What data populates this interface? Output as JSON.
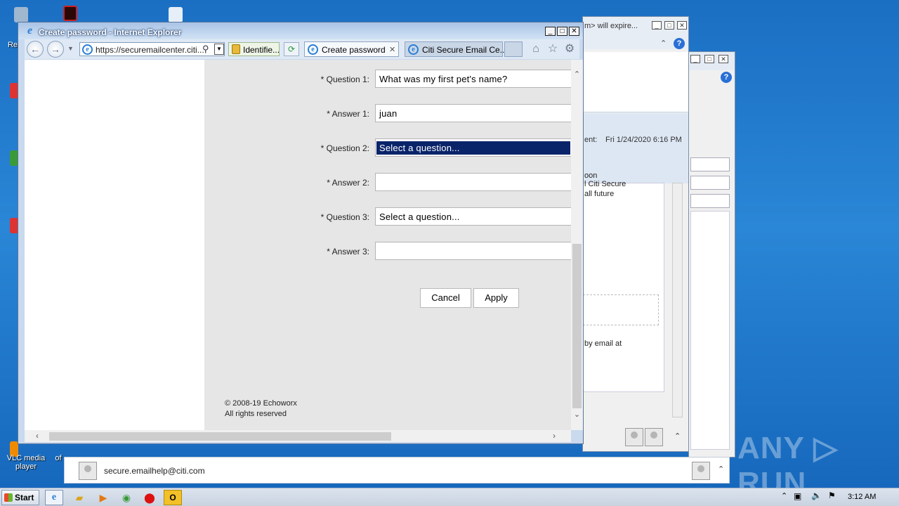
{
  "desktop": {
    "icons": [
      {
        "label": "Re"
      },
      {
        "label": "VLC media player"
      },
      {
        "label": "of"
      }
    ]
  },
  "outlook_bg": {
    "subject_fragment": "m> will expire...",
    "sent_label": "ent:",
    "sent_value": "Fri 1/24/2020 6:16 PM",
    "text_soon": "oon",
    "text_citi": "l Citi Secure",
    "text_future": "all future",
    "text_email": "by email at",
    "people_email": "secure.emailhelp@citi.com"
  },
  "ie": {
    "title": "Create password - Internet Explorer",
    "address": "https://securemailcenter.citi...",
    "identify": "Identifie...",
    "tabs": [
      {
        "label": "Create password"
      },
      {
        "label": "Citi Secure Email Ce..."
      }
    ],
    "new_tab_label": ""
  },
  "form": {
    "rows": [
      {
        "label": "* Question 1:",
        "value": "What was my first pet's name?"
      },
      {
        "label": "* Answer 1:",
        "value": "juan"
      },
      {
        "label": "* Question 2:",
        "value": "Select a question..."
      },
      {
        "label": "* Answer 2:",
        "value": ""
      },
      {
        "label": "* Question 3:",
        "value": "Select a question..."
      },
      {
        "label": "* Answer 3:",
        "value": ""
      }
    ],
    "cancel_label": "Cancel",
    "apply_label": "Apply",
    "footer_line1": "© 2008-19 Echoworx",
    "footer_line2": "All rights reserved"
  },
  "taskbar": {
    "start_label": "Start",
    "clock": "3:12 AM"
  },
  "watermark": "ANY ▷ RUN",
  "colors": {
    "desktop": "#1f78cc",
    "selection": "#0a246a",
    "page_bg": "#e6e6e6"
  }
}
